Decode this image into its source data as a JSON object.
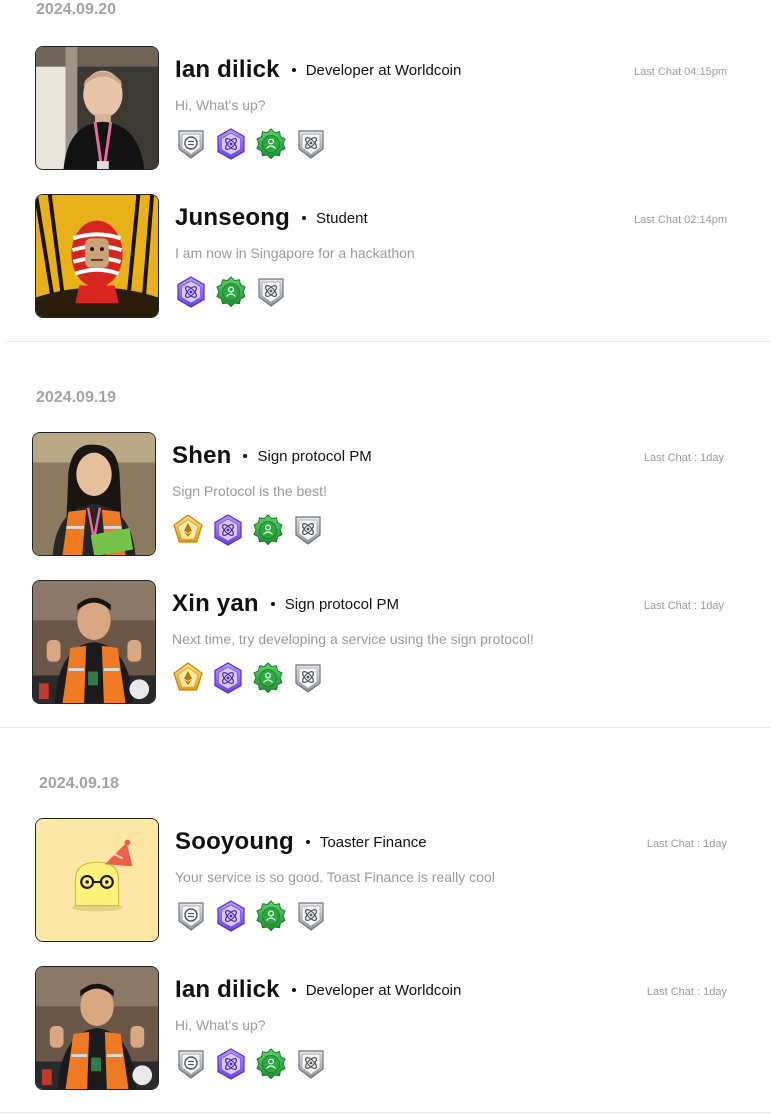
{
  "sections": [
    {
      "date": "2024.09.20",
      "chats": [
        {
          "name": "Ian dilick",
          "role": "Developer at Worldcoin",
          "last_chat": "Last Chat 04:15pm",
          "message": "Hi, What's up?",
          "avatar": "photo-man-black-shirt",
          "badges": [
            "silver-coin-badge-icon",
            "purple-atom-badge-icon",
            "green-person-badge-icon",
            "silver-atom-badge-icon"
          ]
        },
        {
          "name": "Junseong",
          "role": "Student",
          "last_chat": "Last Chat 02:14pm",
          "message": "I am now in Singapore for a hackathon",
          "avatar": "illustration-red-striped-figure",
          "badges": [
            "purple-atom-badge-icon",
            "green-person-badge-icon",
            "silver-atom-badge-icon"
          ]
        }
      ]
    },
    {
      "date": "2024.09.19",
      "chats": [
        {
          "name": "Shen",
          "role": "Sign protocol PM",
          "last_chat": "Last Chat : 1day",
          "message": "Sign Protocol is the best!",
          "avatar": "photo-woman-orange-vest",
          "badges": [
            "gold-ethereum-badge-icon",
            "purple-atom-badge-icon",
            "green-person-badge-icon",
            "silver-atom-badge-icon"
          ]
        },
        {
          "name": "Xin yan",
          "role": "Sign protocol PM",
          "last_chat": "Last Chat : 1day",
          "message": "Next time, try developing a service using the sign protocol!",
          "avatar": "photo-man-orange-vest",
          "badges": [
            "gold-ethereum-badge-icon",
            "purple-atom-badge-icon",
            "green-person-badge-icon",
            "silver-atom-badge-icon"
          ]
        }
      ]
    },
    {
      "date": "2024.09.18",
      "chats": [
        {
          "name": "Sooyoung",
          "role": "Toaster Finance",
          "last_chat": "Last Chat : 1day",
          "message": "Your service is so good. Toast Finance is really cool",
          "avatar": "illustration-toast-party-hat",
          "badges": [
            "silver-coin-badge-icon",
            "purple-atom-badge-icon",
            "green-person-badge-icon",
            "silver-atom-badge-icon"
          ]
        },
        {
          "name": "Ian dilick",
          "role": "Developer at Worldcoin",
          "last_chat": "Last Chat : 1day",
          "message": "Hi, What's up?",
          "avatar": "photo-man-orange-vest",
          "badges": [
            "silver-coin-badge-icon",
            "purple-atom-badge-icon",
            "green-person-badge-icon",
            "silver-atom-badge-icon"
          ]
        }
      ]
    }
  ],
  "colors": {
    "accent_purple": "#8b5cf6",
    "accent_green": "#22a63a",
    "accent_gold": "#f2b52e",
    "silver": "#9ea3a8",
    "muted_text": "#9a9a9a"
  }
}
